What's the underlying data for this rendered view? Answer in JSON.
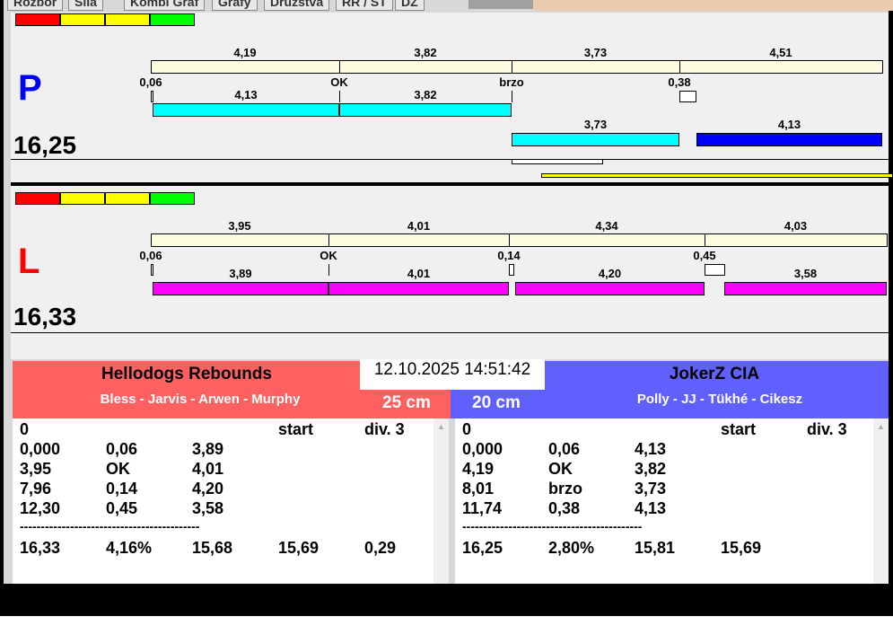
{
  "tabs": [
    "Rozbor",
    "Sila",
    "Kombi Graf",
    "Grafy",
    "Družstva",
    "RR / ST",
    "DZ"
  ],
  "colors": {
    "red": "#ff0000",
    "yellow": "#ffff00",
    "green": "#00ff00",
    "cyan": "#00ffff",
    "blue": "#0000ff",
    "magenta": "#ff00ff",
    "left_team": "#ff6060",
    "right_team": "#6060ff"
  },
  "top": {
    "letter": "P",
    "total": "16,25",
    "segment_labels": [
      "4,19",
      "3,82",
      "3,73",
      "4,51"
    ],
    "marker_labels": [
      "0,06",
      "OK",
      "brzo",
      "0,38"
    ],
    "bar_labels_row1": [
      "4,13",
      "3,82"
    ],
    "bar_labels_row2": [
      "3,73",
      "4,13"
    ]
  },
  "bottom": {
    "letter": "L",
    "total": "16,33",
    "segment_labels": [
      "3,95",
      "4,01",
      "4,34",
      "4,03"
    ],
    "marker_labels": [
      "0,06",
      "OK",
      "0,14",
      "0,45"
    ],
    "bar_labels": [
      "3,89",
      "4,01",
      "4,20",
      "3,58"
    ]
  },
  "datetime": "12.10.2025 14:51:42",
  "left_team": {
    "name": "Hellodogs Rebounds",
    "dogs": "Bless - Jarvis - Arwen - Murphy",
    "height": "25 cm",
    "header": [
      "0",
      "start",
      "div.  3"
    ],
    "rows": [
      [
        "0,000",
        "0,06",
        "3,89"
      ],
      [
        "3,95",
        "OK",
        "4,01"
      ],
      [
        "7,96",
        "0,14",
        "4,20"
      ],
      [
        "12,30",
        "0,45",
        "3,58"
      ]
    ],
    "separator": "-------------------------------------------",
    "summary": [
      "16,33",
      "4,16%",
      "15,68",
      "15,69",
      "0,29"
    ]
  },
  "right_team": {
    "name": "JokerZ CIA",
    "dogs": "Polly - JJ - Tükhé - Cikesz",
    "height": "20 cm",
    "header": [
      "0",
      "start",
      "div.  3"
    ],
    "rows": [
      [
        "0,000",
        "0,06",
        "4,13"
      ],
      [
        "4,19",
        "OK",
        "3,82"
      ],
      [
        "8,01",
        "brzo",
        "3,73"
      ],
      [
        "11,74",
        "0,38",
        "4,13"
      ]
    ],
    "separator": "-------------------------------------------",
    "summary": [
      "16,25",
      "2,80%",
      "15,81",
      "15,69"
    ]
  }
}
